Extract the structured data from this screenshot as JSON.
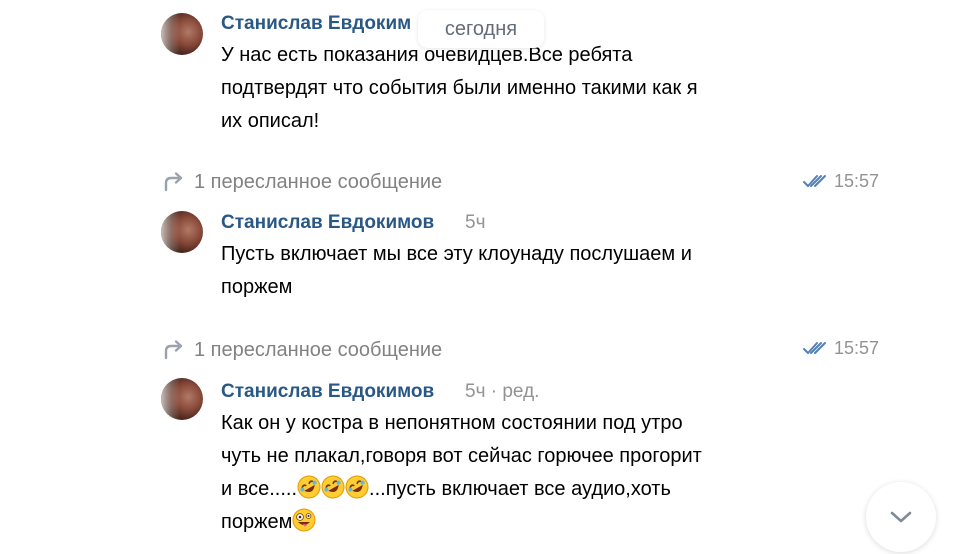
{
  "date_pill": "сегодня",
  "messages": [
    {
      "author": "Станислав Евдоким",
      "meta": "",
      "lines": [
        "У нас есть показания очевидцев.Все ребята",
        "подтвердят что события были именно такими как я",
        "их описал!"
      ]
    },
    {
      "author": "Станислав Евдокимов",
      "meta": "5ч",
      "lines": [
        "Пусть включает мы все эту клоунаду послушаем и",
        "поржем"
      ]
    },
    {
      "author": "Станислав Евдокимов",
      "meta": "5ч · ред.",
      "lines": [
        "Как он у костра в непонятном состоянии под утро",
        "чуть не плакал,говоря вот сейчас горючее прогорит",
        "и все.....",
        "...пусть включает все аудио,хоть",
        "поржем"
      ]
    }
  ],
  "forwarded": [
    {
      "label": "1 пересланное сообщение",
      "time": "15:57"
    },
    {
      "label": "1 пересланное сообщение",
      "time": "15:57"
    }
  ],
  "icons": {
    "forward": "forward-arrow-icon",
    "read": "double-check-icon",
    "laugh": "rolling-on-floor-laughing-emoji",
    "crazy": "zany-face-emoji",
    "scroll": "chevron-down-icon"
  },
  "colors": {
    "author": "#2a5885",
    "meta": "#939393",
    "check": "#5181b8"
  }
}
